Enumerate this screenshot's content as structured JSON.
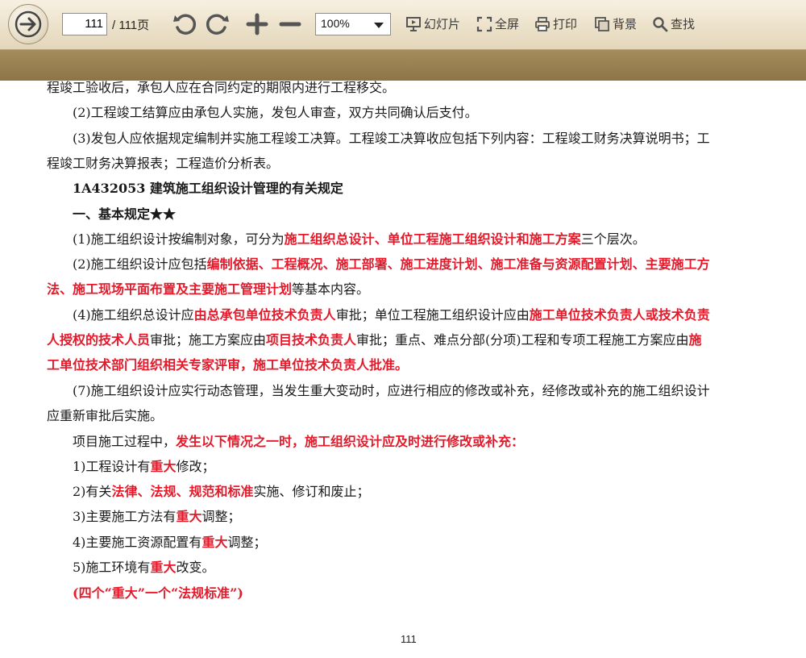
{
  "toolbar": {
    "page_current": "111",
    "page_total": "/ 111页",
    "zoom": "100%",
    "slideshow": "幻灯片",
    "fullscreen": "全屏",
    "print": "打印",
    "background": "背景",
    "find": "查找"
  },
  "doc": {
    "l1": "程竣工验收后，承包人应在合同约定的期限内进行工程移交。",
    "l2": "(2)工程竣工结算应由承包人实施，发包人审查，双方共同确认后支付。",
    "l3": "(3)发包人应依据规定编制并实施工程竣工决算。工程竣工决算收应包括下列内容：工程竣工财务决算说明书；工",
    "l4": "程竣工财务决算报表；工程造价分析表。",
    "h1": "1A432053 建筑施工组织设计管理的有关规定",
    "h2": "一、基本规定★★",
    "p1a": "(1)施工组织设计按编制对象，可分为",
    "p1b": "施工组织总设计、单位工程施工组织设计和施工方案",
    "p1c": "三个层次。",
    "p2a": "(2)施工组织设计应包括",
    "p2b": "编制依据、工程概况、施工部署、施工进度计划、施工准备与资源配置计划、主要施工方",
    "p2c": "法、施工现场平面布置及主要施工管理计划",
    "p2d": "等基本内容。",
    "p4a": "(4)施工组织总设计应",
    "p4b": "由总承包单位技术负责人",
    "p4c": "审批；单位工程施工组织设计应由",
    "p4d": "施工单位技术负责人或技术负责",
    "p4e": "人授权的技术人员",
    "p4f": "审批；施工方案应由",
    "p4g": "项目技术负责人",
    "p4h": "审批；重点、难点分部(分项)工程和专项工程施工方案应由",
    "p4i": "施",
    "p4j": "工单位技术部门组织相关专家评审，施工单位技术负责人批准。",
    "p7a": "(7)施工组织设计应实行动态管理，当发生重大变动时，应进行相应的修改或补充，经修改或补充的施工组织设计",
    "p7b": "应重新审批后实施。",
    "pa": "项目施工过程中，",
    "pb": "发生以下情况之一时，施工组织设计应及时进行修改或补充：",
    "i1a": "1)工程设计有",
    "i1b": "重大",
    "i1c": "修改；",
    "i2a": "2)有关",
    "i2b": "法律、法规、规范和标准",
    "i2c": "实施、修订和废止；",
    "i3a": "3)主要施工方法有",
    "i3b": "重大",
    "i3c": "调整；",
    "i4a": "4)主要施工资源配置有",
    "i4b": "重大",
    "i4c": "调整；",
    "i5a": "5)施工环境有",
    "i5b": "重大",
    "i5c": "改变。",
    "note": "(四个“重大”一个“法规标准”)",
    "page_number": "111"
  },
  "colors": {
    "highlight": "#e6192a",
    "toolbar": "#ebe0c8",
    "band": "#9a8152"
  },
  "icons": [
    "arrow-right-icon",
    "undo-icon",
    "redo-icon",
    "zoom-in-icon",
    "zoom-out-icon",
    "slideshow-icon",
    "fullscreen-icon",
    "print-icon",
    "background-icon",
    "search-icon"
  ]
}
